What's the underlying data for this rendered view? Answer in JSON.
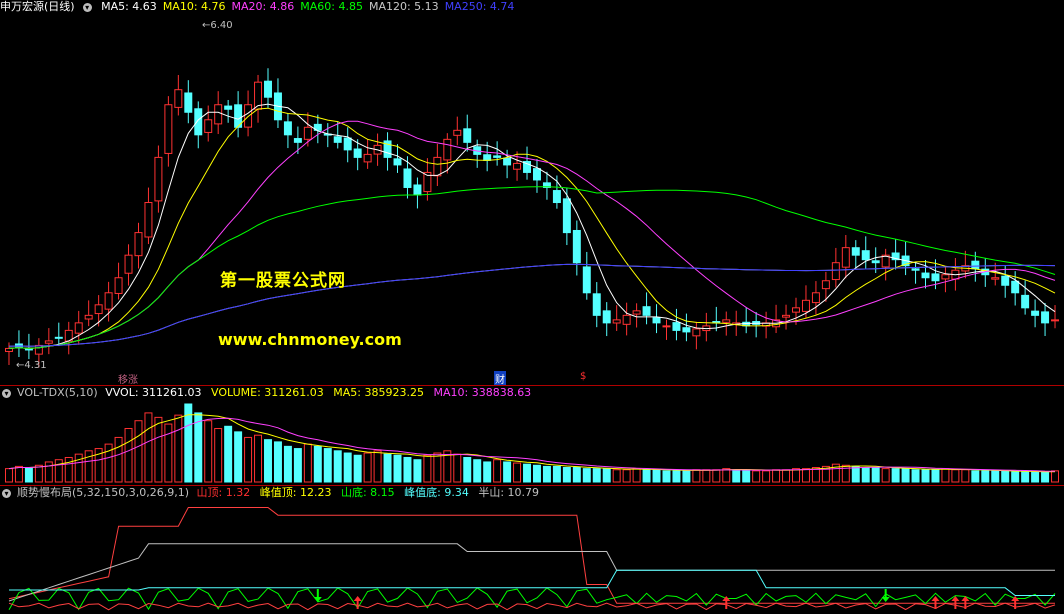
{
  "main": {
    "stock_name": "申万宏源",
    "period": "(日线)",
    "ma": [
      {
        "label": "MA5: 4.63",
        "color": "#ffffff"
      },
      {
        "label": "MA10: 4.76",
        "color": "#ffff00"
      },
      {
        "label": "MA20: 4.86",
        "color": "#ff40ff"
      },
      {
        "label": "MA60: 4.85",
        "color": "#00ff00"
      },
      {
        "label": "MA120: 5.13",
        "color": "#c8c8c8"
      },
      {
        "label": "MA250: 4.74",
        "color": "#4040ff"
      }
    ],
    "high_label": "6.40",
    "low_label": "4.31",
    "watermark_cn": "第一股票公式网",
    "watermark_url": "www.chnmoney.com",
    "markers": [
      "移涨",
      "财",
      "$"
    ]
  },
  "volume": {
    "name": "VOL-TDX(5,10)",
    "vvol": "VVOL: 311261.03",
    "volume": "VOLUME: 311261.03",
    "ma5": "MA5: 385923.25",
    "ma10": "MA10: 338838.63"
  },
  "indicator": {
    "name": "顺势慢布局(5,32,150,3,0,26,9,1)",
    "shanding": "山顶: 1.32",
    "fengzhiding": "峰值顶: 12.23",
    "shandi": "山底: 8.15",
    "fengzhidi": "峰值底: 9.34",
    "banshan": "半山: 10.79"
  },
  "colors": {
    "up": "#ff3232",
    "down": "#54ffff",
    "separator": "#b00000"
  },
  "chart_data": {
    "type": "candlestick",
    "y_range": [
      4.2,
      6.5
    ],
    "high": 6.4,
    "low": 4.31,
    "close_trend": [
      4.33,
      4.34,
      4.32,
      4.35,
      4.38,
      4.4,
      4.45,
      4.5,
      4.55,
      4.62,
      4.7,
      4.8,
      4.95,
      5.1,
      5.3,
      5.6,
      5.95,
      6.05,
      5.9,
      5.75,
      5.85,
      5.95,
      5.92,
      5.8,
      5.95,
      6.1,
      6.0,
      5.85,
      5.75,
      5.7,
      5.8,
      5.78,
      5.75,
      5.7,
      5.65,
      5.6,
      5.62,
      5.68,
      5.6,
      5.55,
      5.4,
      5.35,
      5.5,
      5.6,
      5.72,
      5.78,
      5.7,
      5.62,
      5.58,
      5.6,
      5.55,
      5.56,
      5.5,
      5.45,
      5.4,
      5.3,
      5.1,
      4.9,
      4.7,
      4.55,
      4.5,
      4.52,
      4.55,
      4.58,
      4.55,
      4.5,
      4.48,
      4.45,
      4.44,
      4.46,
      4.48,
      4.5,
      4.52,
      4.5,
      4.48,
      4.49,
      4.5,
      4.52,
      4.55,
      4.6,
      4.65,
      4.7,
      4.78,
      4.9,
      5.0,
      4.95,
      4.92,
      4.9,
      4.95,
      4.92,
      4.88,
      4.85,
      4.8,
      4.78,
      4.82,
      4.85,
      4.88,
      4.86,
      4.82,
      4.8,
      4.75,
      4.7,
      4.6,
      4.55,
      4.5,
      4.52
    ],
    "volume_trend": [
      12,
      14,
      13,
      15,
      18,
      20,
      22,
      25,
      28,
      30,
      34,
      40,
      48,
      55,
      62,
      58,
      52,
      60,
      70,
      62,
      55,
      48,
      50,
      45,
      40,
      42,
      38,
      36,
      32,
      30,
      34,
      32,
      30,
      28,
      26,
      24,
      26,
      28,
      25,
      24,
      22,
      20,
      24,
      26,
      28,
      25,
      22,
      20,
      18,
      20,
      18,
      17,
      16,
      15,
      14,
      14,
      13,
      13,
      12,
      12,
      12,
      11,
      11,
      12,
      11,
      11,
      10,
      10,
      10,
      11,
      11,
      11,
      12,
      11,
      11,
      10,
      10,
      11,
      11,
      12,
      12,
      13,
      14,
      16,
      15,
      14,
      13,
      13,
      12,
      12,
      12,
      11,
      11,
      11,
      12,
      11,
      11,
      10,
      10,
      10,
      10,
      9,
      9,
      9,
      9,
      10
    ]
  }
}
